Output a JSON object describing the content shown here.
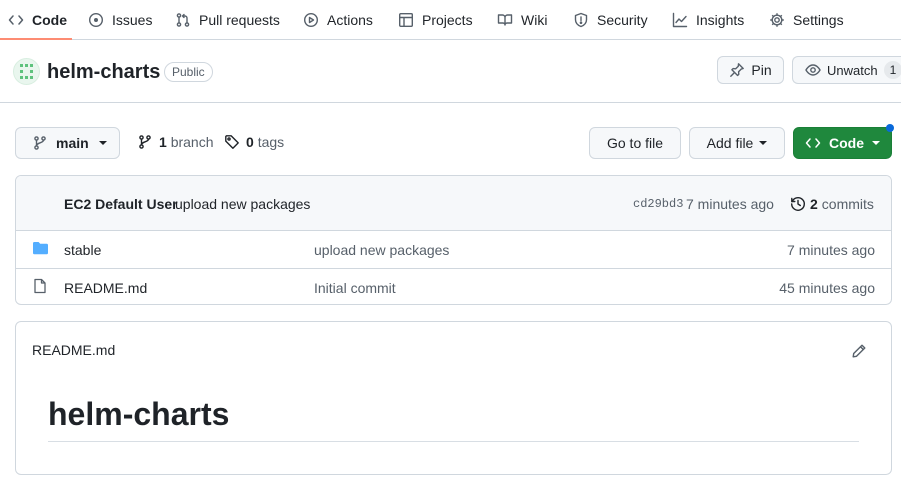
{
  "nav": {
    "tabs": [
      {
        "label": "Code",
        "icon": "code-icon",
        "selected": true
      },
      {
        "label": "Issues",
        "icon": "issue-icon"
      },
      {
        "label": "Pull requests",
        "icon": "pull-request-icon"
      },
      {
        "label": "Actions",
        "icon": "play-icon"
      },
      {
        "label": "Projects",
        "icon": "table-icon"
      },
      {
        "label": "Wiki",
        "icon": "book-icon"
      },
      {
        "label": "Security",
        "icon": "shield-icon"
      },
      {
        "label": "Insights",
        "icon": "graph-icon"
      },
      {
        "label": "Settings",
        "icon": "gear-icon"
      }
    ]
  },
  "repo": {
    "name": "helm-charts",
    "visibility": "Public",
    "pin_label": "Pin",
    "watch_label": "Unwatch",
    "watch_count": "1"
  },
  "toolbar": {
    "branch": "main",
    "branch_count": "1",
    "branch_word": "branch",
    "tag_count": "0",
    "tag_word": "tags",
    "go_to_file": "Go to file",
    "add_file": "Add file",
    "code_button": "Code"
  },
  "latest_commit": {
    "author": "EC2 Default User",
    "message": "upload new packages",
    "sha": "cd29bd3",
    "time": "7 minutes ago",
    "commit_count": "2",
    "commit_word": "commits"
  },
  "files": [
    {
      "name": "stable",
      "type": "folder",
      "message": "upload new packages",
      "time": "7 minutes ago"
    },
    {
      "name": "README.md",
      "type": "file",
      "message": "Initial commit",
      "time": "45 minutes ago"
    }
  ],
  "readme": {
    "filename": "README.md",
    "heading": "helm-charts"
  },
  "colors": {
    "accent_underline": "#fd8c73",
    "primary_button": "#1f883d",
    "folder_icon": "#54aeff",
    "notification_dot": "#0969da"
  }
}
